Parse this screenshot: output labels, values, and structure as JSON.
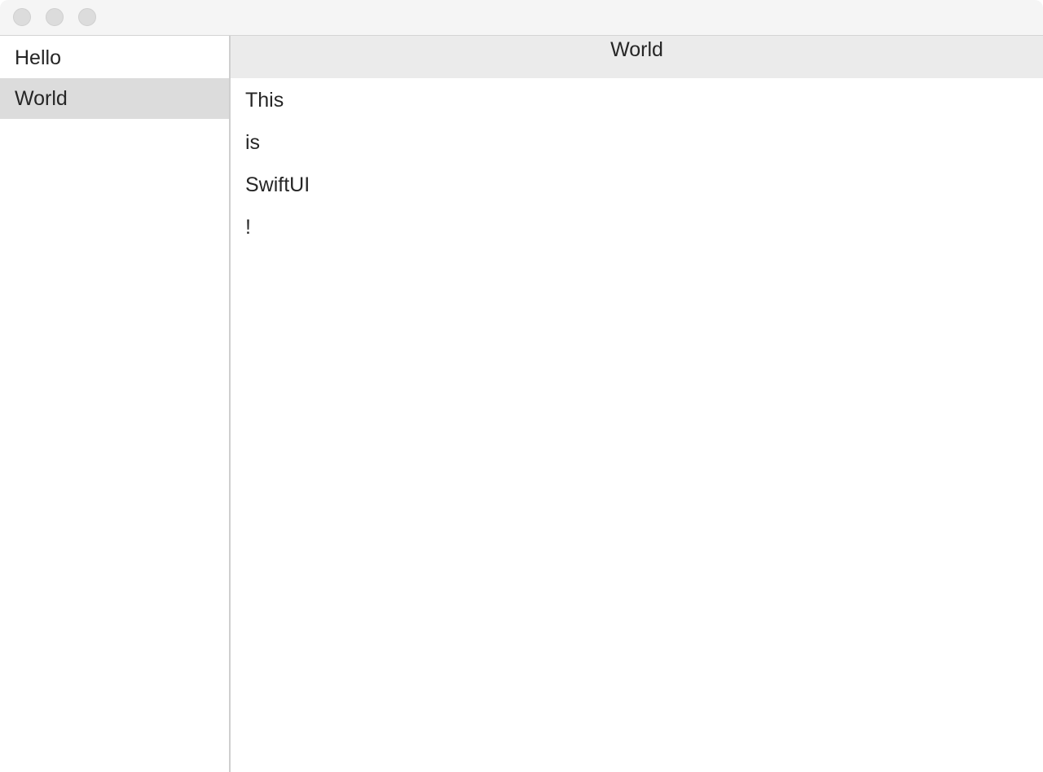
{
  "window": {
    "buttons": [
      "close",
      "minimize",
      "zoom"
    ]
  },
  "sidebar": {
    "items": [
      {
        "label": "Hello",
        "selected": false
      },
      {
        "label": "World",
        "selected": true
      }
    ]
  },
  "detail": {
    "title": "World",
    "rows": [
      "This",
      "is",
      "SwiftUI",
      "!"
    ]
  },
  "colors": {
    "titlebar": "#f5f5f5",
    "selection": "#dcdcdc",
    "header": "#ebebeb",
    "text": "#262626"
  }
}
